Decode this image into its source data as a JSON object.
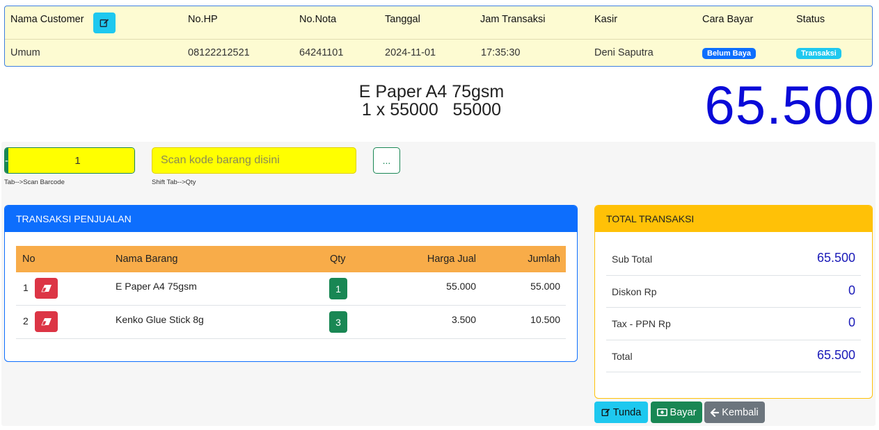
{
  "header": {
    "columns": {
      "customer": "Nama Customer",
      "hp": "No.HP",
      "nota": "No.Nota",
      "tanggal": "Tanggal",
      "jam": "Jam Transaksi",
      "kasir": "Kasir",
      "cara_bayar": "Cara Bayar",
      "status": "Status"
    },
    "values": {
      "customer": "Umum",
      "hp": "08122212521",
      "nota": "64241101",
      "tanggal": "2024-11-01",
      "jam": "17:35:30",
      "kasir": "Deni Saputra",
      "cara_bayar": "Belum Baya",
      "status": "Transaksi"
    }
  },
  "display": {
    "product_name": "E Paper A4 75gsm",
    "product_calc": "1 x 55000   55000",
    "grand_total": "65.500"
  },
  "entry": {
    "minus_label": "-",
    "qty_value": "1",
    "plus_label": "+",
    "qty_hint": "Tab-->Scan Barcode",
    "scan_placeholder": "Scan kode barang disini",
    "scan_hint": "Shift Tab-->Qty",
    "more_label": "..."
  },
  "transaksi": {
    "title": "TRANSAKSI PENJUALAN",
    "columns": {
      "no": "No",
      "nama": "Nama Barang",
      "qty": "Qty",
      "harga": "Harga Jual",
      "jumlah": "Jumlah"
    },
    "rows": [
      {
        "no": "1",
        "nama": "E Paper A4 75gsm",
        "qty": "1",
        "harga": "55.000",
        "jumlah": "55.000"
      },
      {
        "no": "2",
        "nama": "Kenko Glue Stick 8g",
        "qty": "3",
        "harga": "3.500",
        "jumlah": "10.500"
      }
    ]
  },
  "total": {
    "title": "TOTAL TRANSAKSI",
    "rows": [
      {
        "label": "Sub Total",
        "value": "65.500"
      },
      {
        "label": "Diskon Rp",
        "value": "0"
      },
      {
        "label": "Tax - PPN Rp",
        "value": "0"
      },
      {
        "label": "Total",
        "value": "65.500"
      }
    ]
  },
  "actions": {
    "tunda": "Tunda",
    "bayar": "Bayar",
    "kembali": "Kembali"
  },
  "icons": {
    "edit": "edit-icon",
    "eraser": "eraser-icon",
    "money": "money-icon",
    "arrow_left": "arrow-left-icon"
  },
  "colors": {
    "primary": "#0d6efd",
    "success": "#198754",
    "info": "#1ec8ef",
    "warning": "#ffc107",
    "danger": "#dc3545",
    "secondary": "#6c757d",
    "total_blue": "#0a0ad8",
    "table_head": "#f8ac49",
    "input_yellow": "#ffff00"
  }
}
